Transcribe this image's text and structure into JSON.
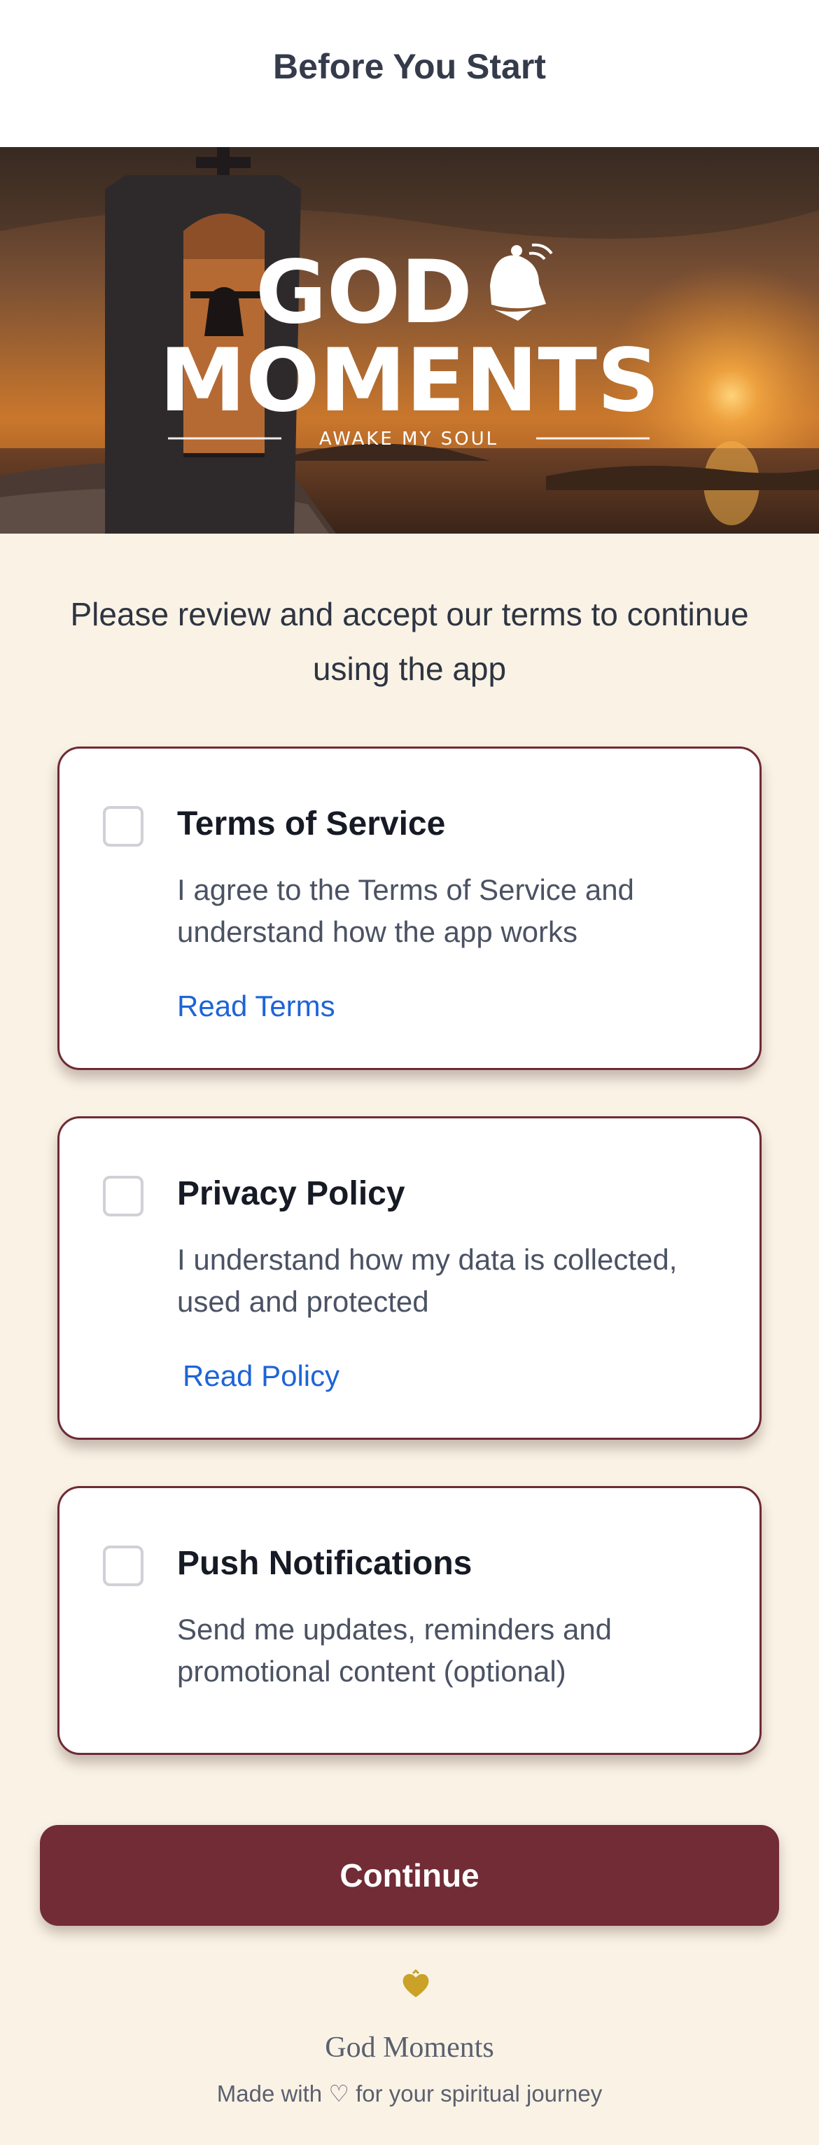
{
  "header": {
    "title": "Before You Start"
  },
  "hero": {
    "logo_line1": "GOD",
    "logo_line2": "MOMENTS",
    "logo_tagline": "AWAKE MY SOUL",
    "icon": "bell-icon"
  },
  "intro": {
    "text": "Please review and accept our terms to continue using the app"
  },
  "consents": [
    {
      "title": "Terms of Service",
      "description": "I agree to the Terms of Service and understand how the app works",
      "link": "Read Terms",
      "checked": false
    },
    {
      "title": "Privacy Policy",
      "description": "I understand how my data is collected, used and protected",
      "link": "Read Policy",
      "checked": false
    },
    {
      "title": "Push Notifications",
      "description": "Send me updates, reminders and promotional content (optional)",
      "checked": false
    }
  ],
  "actions": {
    "continue_label": "Continue"
  },
  "footer": {
    "icon": "heart-icon",
    "brand": "God Moments",
    "tagline": "Made with ♡ for your spiritual journey"
  },
  "colors": {
    "background": "#faf3e5",
    "accent": "#712c36",
    "link": "#1e64d6",
    "footer_icon": "#c9a227"
  }
}
